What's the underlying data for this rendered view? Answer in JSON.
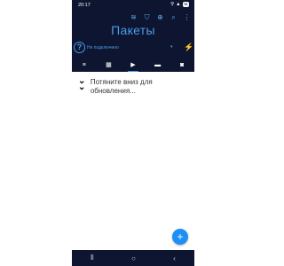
{
  "status_bar": {
    "time": "20:17",
    "battery": "76"
  },
  "header": {
    "title": "Пакеты",
    "actions": [
      {
        "icon": "wifi-icon",
        "glyph": "≋"
      },
      {
        "icon": "filter-icon",
        "glyph": "⛉"
      },
      {
        "icon": "add-circle-icon",
        "glyph": "⊕"
      },
      {
        "icon": "search-icon",
        "glyph": "⌕"
      },
      {
        "icon": "more-icon",
        "glyph": "⋮"
      }
    ]
  },
  "connection": {
    "status": "Не подключено"
  },
  "tabs": [
    {
      "icon": "list-icon",
      "glyph": "≡",
      "active": false
    },
    {
      "icon": "grid-icon",
      "glyph": "▦",
      "active": false
    },
    {
      "icon": "video-icon",
      "glyph": "▶",
      "active": true
    },
    {
      "icon": "image-icon",
      "glyph": "▬",
      "active": false
    },
    {
      "icon": "camera-icon",
      "glyph": "◙",
      "active": false
    }
  ],
  "main": {
    "hint": "Потяните вниз для обновления..."
  },
  "fab": {
    "label": "+"
  },
  "colors": {
    "header_bg": "#0d1530",
    "accent": "#4a9ce8",
    "fab": "#1e90f5"
  }
}
